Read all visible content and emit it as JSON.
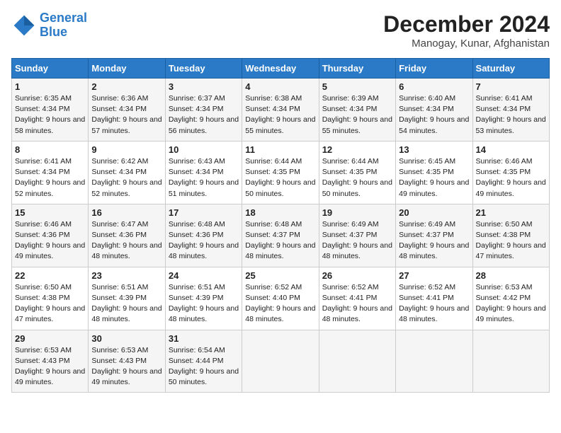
{
  "header": {
    "logo_line1": "General",
    "logo_line2": "Blue",
    "month_title": "December 2024",
    "subtitle": "Manogay, Kunar, Afghanistan"
  },
  "days_of_week": [
    "Sunday",
    "Monday",
    "Tuesday",
    "Wednesday",
    "Thursday",
    "Friday",
    "Saturday"
  ],
  "weeks": [
    [
      {
        "day": 1,
        "sunrise": "6:35 AM",
        "sunset": "4:34 PM",
        "daylight": "9 hours and 58 minutes."
      },
      {
        "day": 2,
        "sunrise": "6:36 AM",
        "sunset": "4:34 PM",
        "daylight": "9 hours and 57 minutes."
      },
      {
        "day": 3,
        "sunrise": "6:37 AM",
        "sunset": "4:34 PM",
        "daylight": "9 hours and 56 minutes."
      },
      {
        "day": 4,
        "sunrise": "6:38 AM",
        "sunset": "4:34 PM",
        "daylight": "9 hours and 55 minutes."
      },
      {
        "day": 5,
        "sunrise": "6:39 AM",
        "sunset": "4:34 PM",
        "daylight": "9 hours and 55 minutes."
      },
      {
        "day": 6,
        "sunrise": "6:40 AM",
        "sunset": "4:34 PM",
        "daylight": "9 hours and 54 minutes."
      },
      {
        "day": 7,
        "sunrise": "6:41 AM",
        "sunset": "4:34 PM",
        "daylight": "9 hours and 53 minutes."
      }
    ],
    [
      {
        "day": 8,
        "sunrise": "6:41 AM",
        "sunset": "4:34 PM",
        "daylight": "9 hours and 52 minutes."
      },
      {
        "day": 9,
        "sunrise": "6:42 AM",
        "sunset": "4:34 PM",
        "daylight": "9 hours and 52 minutes."
      },
      {
        "day": 10,
        "sunrise": "6:43 AM",
        "sunset": "4:34 PM",
        "daylight": "9 hours and 51 minutes."
      },
      {
        "day": 11,
        "sunrise": "6:44 AM",
        "sunset": "4:35 PM",
        "daylight": "9 hours and 50 minutes."
      },
      {
        "day": 12,
        "sunrise": "6:44 AM",
        "sunset": "4:35 PM",
        "daylight": "9 hours and 50 minutes."
      },
      {
        "day": 13,
        "sunrise": "6:45 AM",
        "sunset": "4:35 PM",
        "daylight": "9 hours and 49 minutes."
      },
      {
        "day": 14,
        "sunrise": "6:46 AM",
        "sunset": "4:35 PM",
        "daylight": "9 hours and 49 minutes."
      }
    ],
    [
      {
        "day": 15,
        "sunrise": "6:46 AM",
        "sunset": "4:36 PM",
        "daylight": "9 hours and 49 minutes."
      },
      {
        "day": 16,
        "sunrise": "6:47 AM",
        "sunset": "4:36 PM",
        "daylight": "9 hours and 48 minutes."
      },
      {
        "day": 17,
        "sunrise": "6:48 AM",
        "sunset": "4:36 PM",
        "daylight": "9 hours and 48 minutes."
      },
      {
        "day": 18,
        "sunrise": "6:48 AM",
        "sunset": "4:37 PM",
        "daylight": "9 hours and 48 minutes."
      },
      {
        "day": 19,
        "sunrise": "6:49 AM",
        "sunset": "4:37 PM",
        "daylight": "9 hours and 48 minutes."
      },
      {
        "day": 20,
        "sunrise": "6:49 AM",
        "sunset": "4:37 PM",
        "daylight": "9 hours and 48 minutes."
      },
      {
        "day": 21,
        "sunrise": "6:50 AM",
        "sunset": "4:38 PM",
        "daylight": "9 hours and 47 minutes."
      }
    ],
    [
      {
        "day": 22,
        "sunrise": "6:50 AM",
        "sunset": "4:38 PM",
        "daylight": "9 hours and 47 minutes."
      },
      {
        "day": 23,
        "sunrise": "6:51 AM",
        "sunset": "4:39 PM",
        "daylight": "9 hours and 48 minutes."
      },
      {
        "day": 24,
        "sunrise": "6:51 AM",
        "sunset": "4:39 PM",
        "daylight": "9 hours and 48 minutes."
      },
      {
        "day": 25,
        "sunrise": "6:52 AM",
        "sunset": "4:40 PM",
        "daylight": "9 hours and 48 minutes."
      },
      {
        "day": 26,
        "sunrise": "6:52 AM",
        "sunset": "4:41 PM",
        "daylight": "9 hours and 48 minutes."
      },
      {
        "day": 27,
        "sunrise": "6:52 AM",
        "sunset": "4:41 PM",
        "daylight": "9 hours and 48 minutes."
      },
      {
        "day": 28,
        "sunrise": "6:53 AM",
        "sunset": "4:42 PM",
        "daylight": "9 hours and 49 minutes."
      }
    ],
    [
      {
        "day": 29,
        "sunrise": "6:53 AM",
        "sunset": "4:43 PM",
        "daylight": "9 hours and 49 minutes."
      },
      {
        "day": 30,
        "sunrise": "6:53 AM",
        "sunset": "4:43 PM",
        "daylight": "9 hours and 49 minutes."
      },
      {
        "day": 31,
        "sunrise": "6:54 AM",
        "sunset": "4:44 PM",
        "daylight": "9 hours and 50 minutes."
      },
      null,
      null,
      null,
      null
    ]
  ]
}
